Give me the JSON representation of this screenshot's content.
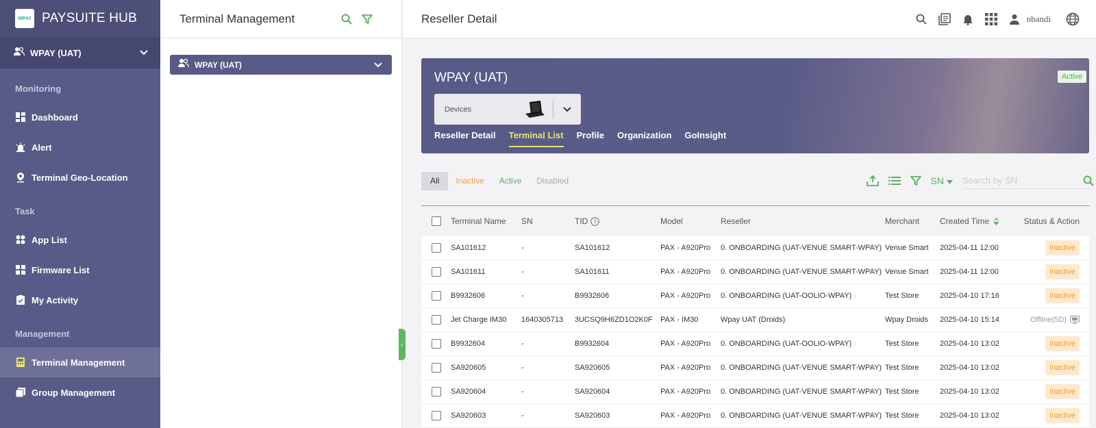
{
  "sidebar": {
    "brand": "PAYSUITE HUB",
    "logo_text": "WPAY",
    "org": "WPAY (UAT)",
    "sections": [
      {
        "title": "Monitoring",
        "items": [
          {
            "label": "Dashboard",
            "icon": "dashboard-icon"
          },
          {
            "label": "Alert",
            "icon": "alert-icon"
          },
          {
            "label": "Terminal Geo-Location",
            "icon": "location-pin-icon"
          }
        ]
      },
      {
        "title": "Task",
        "items": [
          {
            "label": "App List",
            "icon": "apps-icon"
          },
          {
            "label": "Firmware List",
            "icon": "firmware-icon"
          },
          {
            "label": "My Activity",
            "icon": "clipboard-icon"
          }
        ]
      },
      {
        "title": "Management",
        "items": [
          {
            "label": "Terminal Management",
            "icon": "terminal-icon",
            "active": true
          },
          {
            "label": "Group Management",
            "icon": "group-icon"
          }
        ]
      }
    ]
  },
  "middle": {
    "title": "Terminal Management",
    "org": "WPAY (UAT)"
  },
  "header": {
    "title": "Reseller Detail",
    "username": "nbandi"
  },
  "banner": {
    "title": "WPAY (UAT)",
    "status": "Active",
    "devices_label": "Devices",
    "tabs": [
      "Reseller Detail",
      "Terminal List",
      "Profile",
      "Organization",
      "GoInsight"
    ],
    "active_tab": "Terminal List"
  },
  "filters": {
    "all": "All",
    "inactive": "Inactive",
    "active": "Active",
    "disabled": "Disabled",
    "sn_select": "SN",
    "search_placeholder": "Search by SN"
  },
  "table": {
    "headers": {
      "terminal_name": "Terminal Name",
      "sn": "SN",
      "tid": "TID",
      "model": "Model",
      "reseller": "Reseller",
      "merchant": "Merchant",
      "created_time": "Created Time",
      "status_action": "Status & Action"
    },
    "rows": [
      {
        "name": "SA101612",
        "sn": "-",
        "tid": "SA101612",
        "model": "PAX - A920Pro",
        "reseller": "0. ONBOARDING (UAT-VENUE SMART-WPAY)",
        "merchant": "Venue Smart",
        "created": "2025-04-11 12:00",
        "status": "Inactive"
      },
      {
        "name": "SA101611",
        "sn": "-",
        "tid": "SA101611",
        "model": "PAX - A920Pro",
        "reseller": "0. ONBOARDING (UAT-VENUE SMART-WPAY)",
        "merchant": "Venue Smart",
        "created": "2025-04-11 12:00",
        "status": "Inactive"
      },
      {
        "name": "B9932606",
        "sn": "-",
        "tid": "B9932606",
        "model": "PAX - A920Pro",
        "reseller": "0. ONBOARDING (UAT-OOLIO-WPAY)",
        "merchant": "Test Store",
        "created": "2025-04-10 17:16",
        "status": "Inactive"
      },
      {
        "name": "Jet Charge IM30",
        "sn": "1640305713",
        "tid": "3UCSQ9H6ZD1O2K0F",
        "model": "PAX - IM30",
        "reseller": "Wpay UAT (Droids)",
        "merchant": "Wpay Droids",
        "created": "2025-04-10 15:14",
        "status": "Offline(5D)"
      },
      {
        "name": "B9932604",
        "sn": "-",
        "tid": "B9932604",
        "model": "PAX - A920Pro",
        "reseller": "0. ONBOARDING (UAT-OOLIO-WPAY)",
        "merchant": "Test Store",
        "created": "2025-04-10 13:02",
        "status": "Inactive"
      },
      {
        "name": "SA920605",
        "sn": "-",
        "tid": "SA920605",
        "model": "PAX - A920Pro",
        "reseller": "0. ONBOARDING (UAT-VENUE SMART-WPAY)",
        "merchant": "Test Store",
        "created": "2025-04-10 13:02",
        "status": "Inactive"
      },
      {
        "name": "SA920604",
        "sn": "-",
        "tid": "SA920604",
        "model": "PAX - A920Pro",
        "reseller": "0. ONBOARDING (UAT-VENUE SMART-WPAY)",
        "merchant": "Test Store",
        "created": "2025-04-10 13:02",
        "status": "Inactive"
      },
      {
        "name": "SA920603",
        "sn": "-",
        "tid": "SA920603",
        "model": "PAX - A920Pro",
        "reseller": "0. ONBOARDING (UAT-VENUE SMART-WPAY)",
        "merchant": "Test Store",
        "created": "2025-04-10 13:02",
        "status": "Inactive"
      }
    ]
  },
  "colors": {
    "sidebar": "#585a87",
    "accent_green": "#5caf5c",
    "inactive_orange": "#f0a030",
    "active_tab": "#e6e66a"
  }
}
